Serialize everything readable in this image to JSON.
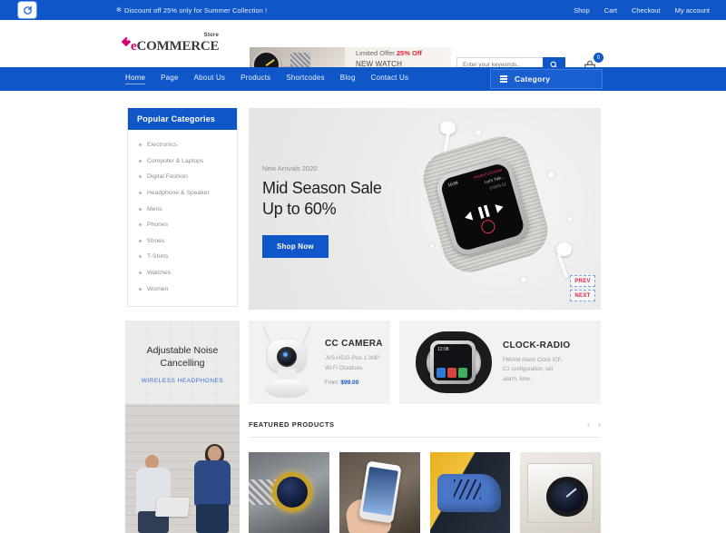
{
  "topbar": {
    "browser_icon": "refresh-icon",
    "promo_star": "✼",
    "promo_text": "Discount off 25% only for Summer Collection !",
    "links": [
      "Shop",
      "Cart",
      "Checkout",
      "My account"
    ]
  },
  "header": {
    "logo": {
      "store": "Store",
      "e": "e",
      "name": "COMMERCE"
    },
    "banner": {
      "line1_pre": "Limited Offer ",
      "line1_strong": "25% Off",
      "line2": "NEW WATCH COLLECTION."
    },
    "search": {
      "placeholder": "Enter your keywords...",
      "value": "",
      "icon": "search-icon"
    },
    "cart": {
      "icon": "cart-icon",
      "count": "0"
    }
  },
  "nav": {
    "items": [
      "Home",
      "Page",
      "About Us",
      "Products",
      "Shortcodes",
      "Blog",
      "Contact Us"
    ],
    "active_index": 0,
    "category_button": {
      "label": "Category",
      "icon": "hamburger-icon"
    }
  },
  "sidebar": {
    "title": "Popular Categories",
    "items": [
      "Electronics",
      "Computer & Laptops",
      "Digital Fashion",
      "Headphone & Speaker",
      "Mens",
      "Phones",
      "Shoes",
      "T-Shirts",
      "Watches",
      "Women"
    ]
  },
  "hero": {
    "eyebrow": "New Arrivals 2020",
    "title_line1": "Mid Season Sale",
    "title_line2": "Up to 60%",
    "cta": "Shop Now",
    "prev": "PREV",
    "next": "NEXT",
    "watch_screen": {
      "time": "10:09",
      "artist": "PHANTOGRAM",
      "track1": "Let's Talk...",
      "track2": "0:00/3:12"
    }
  },
  "promo_card": {
    "heading_line1": "Adjustable Noise",
    "heading_line2": "Cancelling",
    "subheading": "WIRELESS HEADPHONES"
  },
  "product_cards": [
    {
      "title": "CC CAMERA",
      "desc_line1": "JVS-H510-Plus 1.3MP",
      "desc_line2": "Wi-Fi Cloudsee.",
      "price_label": "From:",
      "price": "$99.00"
    },
    {
      "title": "CLOCK-RADIO",
      "desc_line1": "FM/AM Alarm Clock ICF-",
      "desc_line2": "C1 configuration, set",
      "desc_line3": "alarm, time."
    }
  ],
  "featured": {
    "title": "FEATURED PRODUCTS",
    "prev_arrow": "‹",
    "next_arrow": "›",
    "products": [
      {
        "name": "gold-dive-watch"
      },
      {
        "name": "smartphone-in-hand"
      },
      {
        "name": "blue-suede-shoe"
      },
      {
        "name": "boxed-smart-watch"
      }
    ]
  },
  "colors": {
    "brand_blue": "#0f56c9",
    "accent_red": "#e0263d",
    "logo_pink": "#d6006e"
  }
}
